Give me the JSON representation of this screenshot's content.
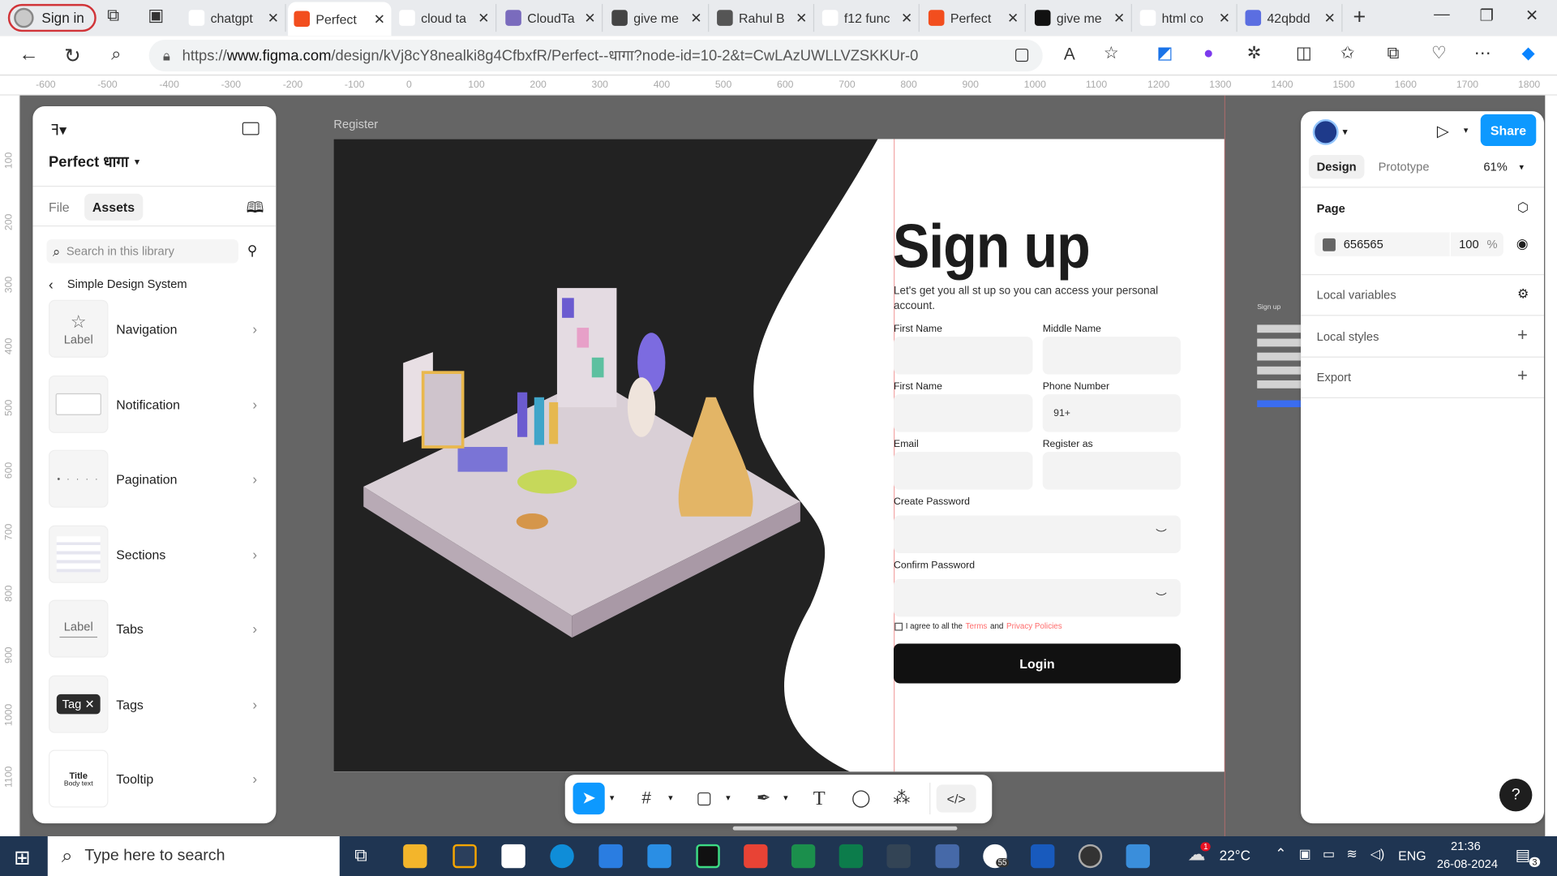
{
  "browser": {
    "signin_label": "Sign in",
    "tabs": [
      {
        "title": "chatgpt",
        "color": "#ffffff"
      },
      {
        "title": "Perfect",
        "color": "#f24e1e"
      },
      {
        "title": "cloud ta",
        "color": "#ffffff"
      },
      {
        "title": "CloudTa",
        "color": "#7a6bbd"
      },
      {
        "title": "give me",
        "color": "#444444"
      },
      {
        "title": "Rahul B",
        "color": "#555555"
      },
      {
        "title": "f12 func",
        "color": "#ffffff"
      },
      {
        "title": "Perfect",
        "color": "#f24e1e"
      },
      {
        "title": "give me",
        "color": "#111111"
      },
      {
        "title": "html co",
        "color": "#ffffff"
      },
      {
        "title": "42qbdd",
        "color": "#5b6ee1"
      }
    ],
    "url_prefix": "https://",
    "url_domain": "www.figma.com",
    "url_path": "/design/kVj8cY8nealki8g4CfbxfR/Perfect--धागा?node-id=10-2&t=CwLAzUWLLVZSKKUr-0"
  },
  "ruler": {
    "h_ticks": [
      "-600",
      "-500",
      "-400",
      "-300",
      "-200",
      "-100",
      "0",
      "100",
      "200",
      "300",
      "400",
      "500",
      "600",
      "700",
      "800",
      "900",
      "1000",
      "1100",
      "1200",
      "1300",
      "1400",
      "1500",
      "1600",
      "1700",
      "1800"
    ],
    "v_ticks": [
      "100",
      "200",
      "300",
      "400",
      "500",
      "600",
      "700",
      "800",
      "900",
      "1000",
      "1100"
    ]
  },
  "left_panel": {
    "file_title": "Perfect धागा",
    "tab_file": "File",
    "tab_assets": "Assets",
    "search_placeholder": "Search in this library",
    "library_name": "Simple Design System",
    "assets": [
      {
        "name": "Navigation",
        "thumb": "Label"
      },
      {
        "name": "Notification",
        "thumb": ""
      },
      {
        "name": "Pagination",
        "thumb": ""
      },
      {
        "name": "Sections",
        "thumb": ""
      },
      {
        "name": "Tabs",
        "thumb": "Label"
      },
      {
        "name": "Tags",
        "thumb": "Tag"
      },
      {
        "name": "Tooltip",
        "thumb_title": "Title",
        "thumb_body": "Body text"
      }
    ]
  },
  "canvas": {
    "frame_label": "Register",
    "heading": "Sign up",
    "subheading": "Let's get you all st up so you can access your personal account.",
    "fields": {
      "first_name": "First Name",
      "middle_name": "Middle Name",
      "first_name_2": "First Name",
      "phone": "Phone Number",
      "phone_value": "91+",
      "email": "Email",
      "register_as": "Register as",
      "create_password": "Create Password",
      "confirm_password": "Confirm Password"
    },
    "agree_prefix": "I agree to all the",
    "agree_terms": "Terms",
    "agree_and": "and",
    "agree_privacy": "Privacy Policies",
    "login_label": "Login",
    "mini_preview_title": "Sign up"
  },
  "right_panel": {
    "share_label": "Share",
    "tab_design": "Design",
    "tab_prototype": "Prototype",
    "zoom": "61%",
    "page_title": "Page",
    "page_color_hex": "656565",
    "page_opacity": "100",
    "page_opacity_unit": "%",
    "local_variables": "Local variables",
    "local_styles": "Local styles",
    "export": "Export"
  },
  "taskbar": {
    "search_placeholder": "Type here to search",
    "weather": "22°C",
    "language": "ENG",
    "time": "21:36",
    "date": "26-08-2024",
    "notification_count": "3",
    "badge_55": "55",
    "weather_badge": "1"
  },
  "colors": {
    "accent_blue": "#0d99ff",
    "dark_panel": "#222222",
    "link_red": "#ff6b6b",
    "taskbar": "#1f3552"
  }
}
